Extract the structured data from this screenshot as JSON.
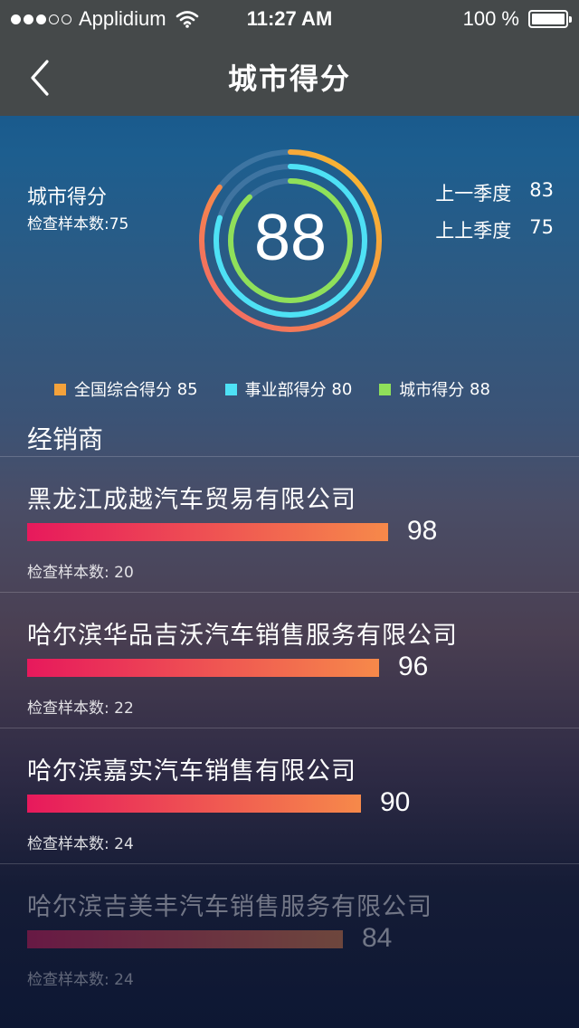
{
  "status_bar": {
    "carrier": "Applidium",
    "time": "11:27 AM",
    "battery": "100 %"
  },
  "nav": {
    "title": "城市得分"
  },
  "summary": {
    "title": "城市得分",
    "sample_label": "检查样本数:75",
    "score": "88",
    "previous": [
      {
        "label": "上一季度",
        "value": "83"
      },
      {
        "label": "上上季度",
        "value": "75"
      }
    ]
  },
  "legend": [
    {
      "label": "全国综合得分",
      "value": "85",
      "color": "#f4a23b"
    },
    {
      "label": "事业部得分",
      "value": "80",
      "color": "#4ee1f5"
    },
    {
      "label": "城市得分",
      "value": "88",
      "color": "#8fe05a"
    }
  ],
  "section": {
    "title": "经销商"
  },
  "dealers": [
    {
      "name": "黑龙江成越汽车贸易有限公司",
      "score": "98",
      "sample": "检查样本数: 20"
    },
    {
      "name": "哈尔滨华品吉沃汽车销售服务有限公司",
      "score": "96",
      "sample": "检查样本数: 22"
    },
    {
      "name": "哈尔滨嘉实汽车销售有限公司",
      "score": "90",
      "sample": "检查样本数: 24"
    },
    {
      "name": "哈尔滨吉美丰汽车销售服务有限公司",
      "score": "84",
      "sample": "检查样本数: 24"
    }
  ]
}
